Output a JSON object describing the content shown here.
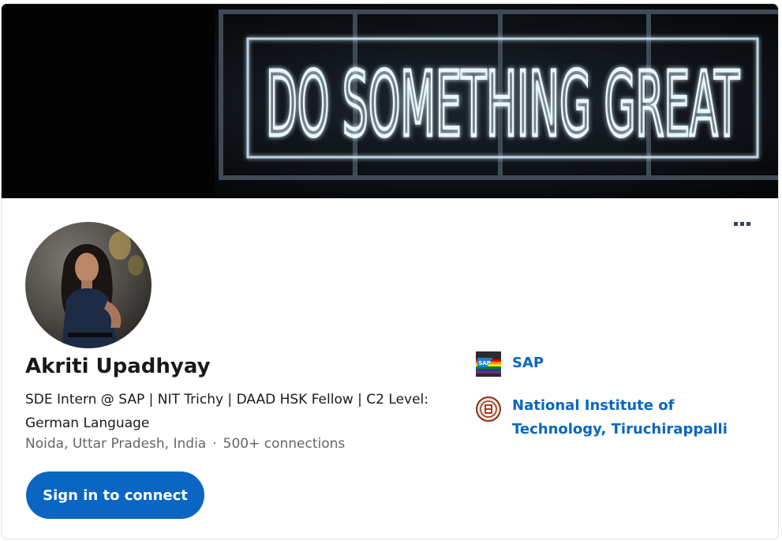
{
  "banner": {
    "neon_text": "DO SOMETHING GREAT"
  },
  "profile": {
    "name": "Akriti Upadhyay",
    "headline": "SDE Intern @ SAP | NIT Trichy | DAAD HSK Fellow | C2 Level: German Language",
    "location": "Noida, Uttar Pradesh, India",
    "separator": "·",
    "connections": "500+ connections"
  },
  "actions": {
    "connect_label": "Sign in to connect",
    "more_icon": "more-horizontal-icon"
  },
  "experience": {
    "company": "SAP",
    "logo_text": "SAP"
  },
  "education": {
    "school": "National Institute of Technology, Tiruchirappalli"
  },
  "colors": {
    "accent": "#0a66c2",
    "text": "#191919",
    "muted": "#666666",
    "banner_bg": "#0a0b0d",
    "neon": "#dff4ff"
  }
}
